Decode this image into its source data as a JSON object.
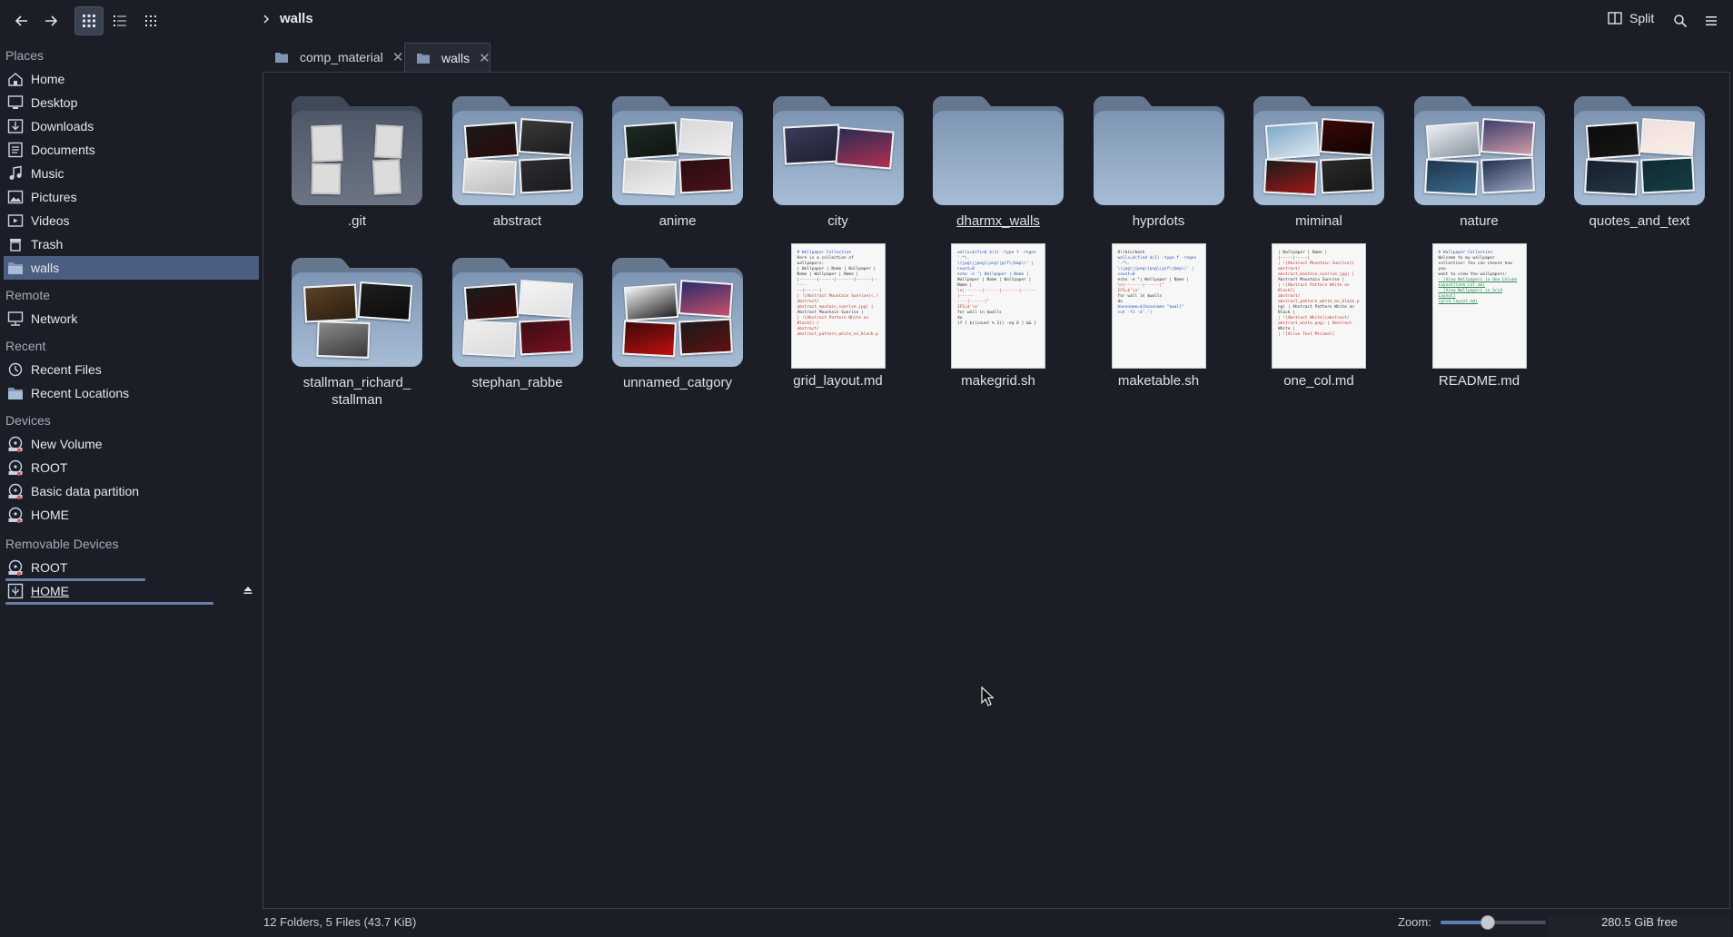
{
  "toolbar": {
    "breadcrumb": "walls",
    "split_label": "Split"
  },
  "sidebar": {
    "places_title": "Places",
    "places": [
      {
        "label": "Home",
        "icon": "home-icon"
      },
      {
        "label": "Desktop",
        "icon": "desktop-icon"
      },
      {
        "label": "Downloads",
        "icon": "downloads-icon"
      },
      {
        "label": "Documents",
        "icon": "documents-icon"
      },
      {
        "label": "Music",
        "icon": "music-icon"
      },
      {
        "label": "Pictures",
        "icon": "pictures-icon"
      },
      {
        "label": "Videos",
        "icon": "videos-icon"
      },
      {
        "label": "Trash",
        "icon": "trash-icon"
      },
      {
        "label": "walls",
        "icon": "folder-icon",
        "selected": true
      }
    ],
    "remote_title": "Remote",
    "remote": [
      {
        "label": "Network",
        "icon": "network-icon"
      }
    ],
    "recent_title": "Recent",
    "recent": [
      {
        "label": "Recent Files",
        "icon": "clock-icon"
      },
      {
        "label": "Recent Locations",
        "icon": "folder-icon"
      }
    ],
    "devices_title": "Devices",
    "devices": [
      {
        "label": "New Volume",
        "icon": "drive-icon"
      },
      {
        "label": "ROOT",
        "icon": "drive-icon"
      },
      {
        "label": "Basic data partition",
        "icon": "drive-icon"
      },
      {
        "label": "HOME",
        "icon": "drive-icon"
      }
    ],
    "removable_title": "Removable Devices",
    "removable": [
      {
        "label": "ROOT",
        "icon": "drive-icon",
        "usage": 0.55
      },
      {
        "label": "HOME",
        "icon": "usb-icon",
        "usage": 0.9
      }
    ]
  },
  "tabs": [
    {
      "label": "comp_material",
      "active": false
    },
    {
      "label": "walls",
      "active": true
    }
  ],
  "folders": [
    {
      "name": ".git",
      "kind": "git"
    },
    {
      "name": "abstract",
      "kind": "thumbs"
    },
    {
      "name": "anime",
      "kind": "thumbs"
    },
    {
      "name": "city",
      "kind": "thumbs"
    },
    {
      "name": "dharmx_walls",
      "kind": "empty"
    },
    {
      "name": "hyprdots",
      "kind": "empty"
    },
    {
      "name": "miminal",
      "kind": "thumbs"
    },
    {
      "name": "nature",
      "kind": "thumbs"
    },
    {
      "name": "quotes_and_text",
      "kind": "thumbs"
    },
    {
      "name": "stallman_richard_\nstallman",
      "kind": "thumbs"
    },
    {
      "name": "stephan_rabbe",
      "kind": "thumbs"
    },
    {
      "name": "unnamed_catgory",
      "kind": "thumbs"
    }
  ],
  "files": [
    {
      "name": "grid_layout.md",
      "preview": [
        {
          "t": "# Wallpaper Collection",
          "c": "b"
        },
        {
          "t": " "
        },
        {
          "t": "Here is a collection of wallpapers:"
        },
        {
          "t": " "
        },
        {
          "t": "| Wallpaper | Name | Wallpaper |"
        },
        {
          "t": "Name | Wallpaper | Name |"
        },
        {
          "t": "|-------|------|-------|------|------"
        },
        {
          "t": "--|------|"
        },
        {
          "t": "| ![Abstract Mountain Sunrise](./",
          "c": "r"
        },
        {
          "t": "abstract/",
          "c": "r"
        },
        {
          "t": "abstract_moutain_sunrise.jpg) |",
          "c": "r"
        },
        {
          "t": "Abstract Mountain Sunrise |"
        },
        {
          "t": "| ![Abstract Pattern White on Black](./",
          "c": "r"
        },
        {
          "t": "abstract/",
          "c": "r"
        },
        {
          "t": "abstract_pattern_white_on_black.p",
          "c": "r"
        }
      ]
    },
    {
      "name": "makegrid.sh",
      "preview": [
        {
          "t": "walls=$(find $(1) -type f -regex '.*\\.",
          "c": "b"
        },
        {
          "t": "\\(jpg\\|jpeg\\|png\\|gif\\|bmp\\)' |",
          "c": "b"
        },
        {
          "t": "count=0",
          "c": "b"
        },
        {
          "t": " "
        },
        {
          "t": "echo -e \"| Wallpaper | Name |",
          "c": "b"
        },
        {
          "t": "Wallpaper | Name | Wallpaper |"
        },
        {
          "t": "Name |"
        },
        {
          "t": "\\n|-------|------|-------|------|------",
          "c": "r"
        },
        {
          "t": "----|------|\"",
          "c": "r"
        },
        {
          "t": " "
        },
        {
          "t": "IFS=$'\\n'",
          "c": "r"
        },
        {
          "t": " "
        },
        {
          "t": "for wall in $walls"
        },
        {
          "t": "do"
        },
        {
          "t": "  if [ $((count % 3)) -eq 0 ] && ["
        }
      ]
    },
    {
      "name": "maketable.sh",
      "preview": [
        {
          "t": "#!/bin/bash"
        },
        {
          "t": " "
        },
        {
          "t": "walls=$(find $(1) -type f -regex '.*\\.",
          "c": "b"
        },
        {
          "t": "\\(jpg\\|jpeg\\|png\\|gif\\|bmp\\)' |",
          "c": "b"
        },
        {
          "t": "count=0",
          "c": "b"
        },
        {
          "t": " "
        },
        {
          "t": "echo -e \"| Wallpaper | Name |"
        },
        {
          "t": "\\n|-------|------|\"",
          "c": "r"
        },
        {
          "t": " "
        },
        {
          "t": "IFS=$'\\n'",
          "c": "r"
        },
        {
          "t": " "
        },
        {
          "t": "for wall in $walls"
        },
        {
          "t": "do"
        },
        {
          "t": "  basename=$(basename \"$wall\"",
          "c": "b"
        },
        {
          "t": "cut -f1 -d'.')",
          "c": "b"
        }
      ]
    },
    {
      "name": "one_col.md",
      "preview": [
        {
          "t": "| Wallpaper | Name |"
        },
        {
          "t": "|-----|-----|"
        },
        {
          "t": "| ![Abstract Mountain Sunrise](",
          "c": "r"
        },
        {
          "t": "abstract/",
          "c": "r"
        },
        {
          "t": "abstract_moutain_sunrise.jpg) |",
          "c": "r"
        },
        {
          "t": "Abstract Mountain Sunrise |"
        },
        {
          "t": "| ![Abstract Pattern White on Black](",
          "c": "r"
        },
        {
          "t": "abstract/",
          "c": "r"
        },
        {
          "t": "abstract_pattern_white_on_black.p",
          "c": "r"
        },
        {
          "t": "ng) | Abstract Pattern White on"
        },
        {
          "t": "Black |"
        },
        {
          "t": "| ![Abstract White](abstract/",
          "c": "r"
        },
        {
          "t": "abstract_white.png) | Abstract",
          "c": "r"
        },
        {
          "t": "White |"
        },
        {
          "t": "| ![Alive Text Minimal]",
          "c": "r"
        }
      ]
    },
    {
      "name": "README.md",
      "preview": [
        {
          "t": "# Wallpaper Collection",
          "c": "b"
        },
        {
          "t": " "
        },
        {
          "t": "Welcome to my wallpaper"
        },
        {
          "t": "collection! You can choose how you"
        },
        {
          "t": "want to view the wallpapers:"
        },
        {
          "t": " "
        },
        {
          "t": "- [View Wallpapers in One Column",
          "c": "g"
        },
        {
          "t": "Layout](one_col.md)",
          "c": "g"
        },
        {
          "t": "- [View Wallpapers in Grid Layout]",
          "c": "g"
        },
        {
          "t": "(grid_layout.md)",
          "c": "g"
        }
      ]
    }
  ],
  "status": {
    "summary": "12 Folders, 5 Files (43.7 KiB)",
    "zoom_label": "Zoom:",
    "zoom_value": 0.45,
    "free_space": "280.5 GiB free"
  },
  "colors": {
    "accent": "#4b5d80",
    "folder_top": "#7e95b3",
    "folder_bottom": "#a7bdd6",
    "background": "#1b1e26"
  }
}
